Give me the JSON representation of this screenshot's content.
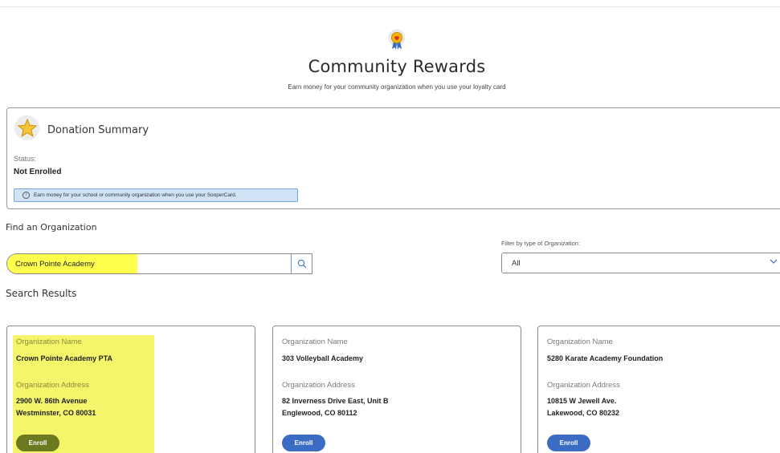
{
  "header": {
    "title": "Community Rewards",
    "subtitle": "Earn money for your community organization when you use your loyalty card"
  },
  "summary": {
    "title": "Donation Summary",
    "status_label": "Status:",
    "status_value": "Not Enrolled",
    "info_text": "Earn money for your school or community organization when you use your SooperCard."
  },
  "find": {
    "heading": "Find an Organization",
    "search_value": "Crown Pointe Academy",
    "filter_label": "Filter by type of Organization:",
    "filter_value": "All"
  },
  "results": {
    "heading": "Search Results",
    "name_label": "Organization Name",
    "address_label": "Organization Address",
    "enroll_label": "Enroll",
    "cards": [
      {
        "name": "Crown Pointe Academy PTA",
        "address_line1": "2900 W. 86th Avenue",
        "address_line2": "Westminster, CO 80031"
      },
      {
        "name": "303 Volleyball Academy",
        "address_line1": "82 Inverness Drive East, Unit B",
        "address_line2": "Englewood, CO 80112"
      },
      {
        "name": "5280 Karate Academy Foundation",
        "address_line1": "10815 W Jewell Ave.",
        "address_line2": "Lakewood, CO 80232"
      }
    ]
  },
  "colors": {
    "highlight": "#ffff4d",
    "primary_button": "#3b6cc4",
    "info_banner": "#cfe3f7"
  },
  "icons": {
    "header": "award-badge-icon",
    "summary": "star-icon",
    "info": "info-icon",
    "search": "search-icon",
    "filter": "chevron-down-icon"
  }
}
